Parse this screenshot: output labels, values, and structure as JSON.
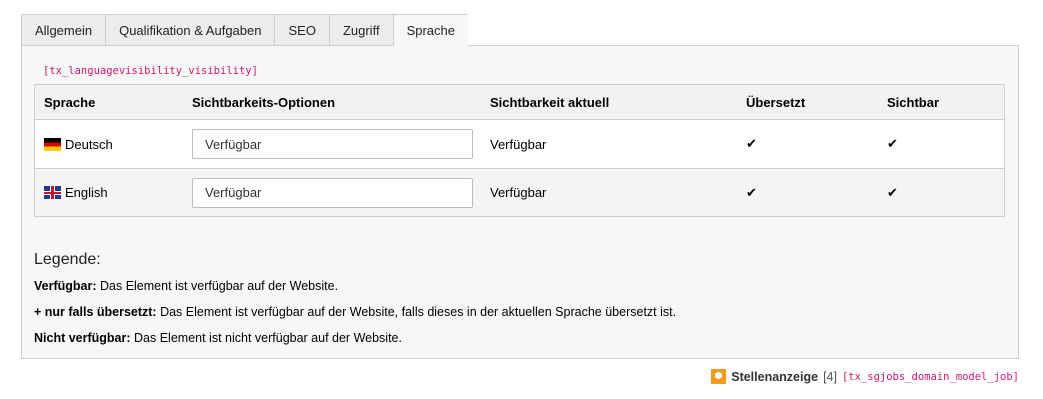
{
  "tabs": [
    "Allgemein",
    "Qualifikation & Aufgaben",
    "SEO",
    "Zugriff",
    "Sprache"
  ],
  "active_tab": "Sprache",
  "field_code": "[tx_languagevisibility_visibility]",
  "table": {
    "headers": [
      "Sprache",
      "Sichtbarkeits-Optionen",
      "Sichtbarkeit aktuell",
      "Übersetzt",
      "Sichtbar"
    ],
    "rows": [
      {
        "flag": "de-flag-icon",
        "language": "Deutsch",
        "option": "Verfügbar",
        "current": "Verfügbar",
        "translated": "✔",
        "visible": "✔"
      },
      {
        "flag": "uk-flag-icon",
        "language": "English",
        "option": "Verfügbar",
        "current": "Verfügbar",
        "translated": "✔",
        "visible": "✔"
      }
    ]
  },
  "legend": {
    "title": "Legende:",
    "items": [
      {
        "term": "Verfügbar:",
        "text": " Das Element ist verfügbar auf der Website."
      },
      {
        "term": "+ nur falls übersetzt:",
        "text": " Das Element ist verfügbar auf der Website, falls dieses in der aktuellen Sprache übersetzt ist."
      },
      {
        "term": "Nicht verfügbar:",
        "text": " Das Element ist nicht verfügbar auf der Website."
      }
    ]
  },
  "footer": {
    "icon": "record-icon",
    "title": "Stellenanzeige",
    "uid": "[4]",
    "table_code": "[tx_sgjobs_domain_model_job]"
  },
  "colors": {
    "code": "#d4176f",
    "icon": "#f59a1b"
  }
}
